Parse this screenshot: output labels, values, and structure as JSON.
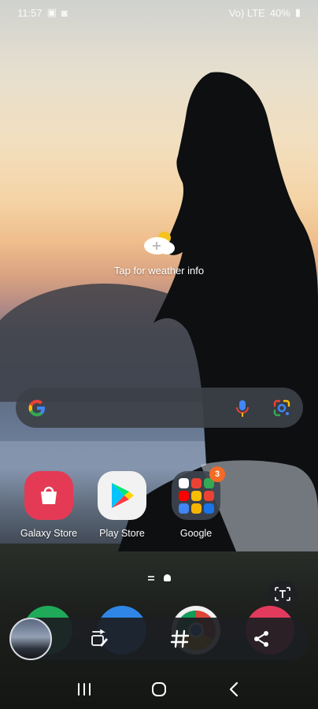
{
  "status_bar": {
    "time": "11:57",
    "left_icons": [
      "gallery-icon",
      "contacts-icon"
    ],
    "right_text": "Vo) LTE",
    "battery": "40%"
  },
  "weather": {
    "label": "Tap for weather info",
    "icon": "weather-add-icon"
  },
  "search_bar": {
    "logo": "google-g-icon",
    "mic_icon": "mic-icon",
    "lens_icon": "google-lens-icon"
  },
  "apps": [
    {
      "label": "Galaxy Store",
      "icon": "galaxy-store-icon",
      "color": "#e43a55"
    },
    {
      "label": "Play Store",
      "icon": "play-store-icon",
      "color": "#f2f2f2"
    },
    {
      "label": "Google",
      "icon": "google-folder-icon",
      "color": "#3f4650",
      "badge": "3"
    }
  ],
  "page_indicator": {
    "pages": 2,
    "current": 2
  },
  "dock": [
    {
      "icon": "phone-icon",
      "color": "#1faa59"
    },
    {
      "icon": "messages-icon",
      "color": "#2f86e6"
    },
    {
      "icon": "chrome-icon",
      "color": "#f0f0f0"
    },
    {
      "icon": "camera-icon",
      "color": "#e23a5c"
    }
  ],
  "screenshot_toolbar": {
    "thumbnail": "screenshot-thumbnail",
    "actions": [
      "scroll-capture-icon",
      "hashtag-icon",
      "share-icon"
    ],
    "text_extract_icon": "text-extract-icon"
  },
  "nav_bar": {
    "buttons": [
      "recents-icon",
      "home-icon",
      "back-icon"
    ]
  }
}
